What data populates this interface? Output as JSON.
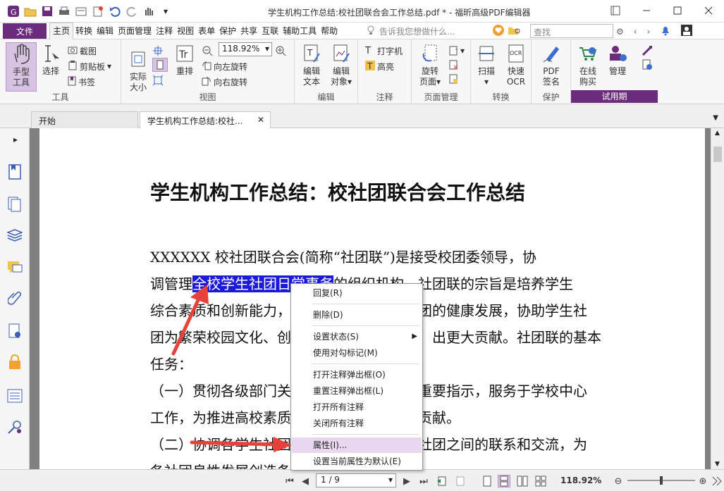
{
  "window": {
    "title": "学生机构工作总结:校社团联合会工作总结.pdf * - 福昕高级PDF编辑器"
  },
  "menu": {
    "file": "文件",
    "items": [
      "主页",
      "转换",
      "编辑",
      "页面管理",
      "注释",
      "视图",
      "表单",
      "保护",
      "共享",
      "互联",
      "辅助工具",
      "帮助"
    ],
    "active_index": 0,
    "tell_me": "告诉我您想做什么...",
    "search_placeholder": "查找"
  },
  "ribbon": {
    "tools": {
      "hand": "手型\n工具",
      "select": "选择",
      "snapshot": "截图",
      "clipboard": "剪贴板",
      "bookmark": "书签",
      "label": "工具"
    },
    "view": {
      "actual_size": "实际\n大小",
      "reflow": "重排",
      "zoom": "118.92%",
      "rotate_left": "向左旋转",
      "rotate_right": "向右旋转",
      "label": "视图"
    },
    "edit": {
      "edit_text": "编辑\n文本",
      "edit_object": "编辑\n对象",
      "label": "编辑"
    },
    "comment": {
      "typewriter": "打字机",
      "highlight": "高亮",
      "label": "注释"
    },
    "pages": {
      "rotate_page": "旋转\n页面",
      "label": "页面管理"
    },
    "convert": {
      "scan": "扫描",
      "ocr": "快速\nOCR",
      "label": "转换"
    },
    "protect": {
      "sign": "PDF\n签名",
      "label": "保护"
    },
    "trial": {
      "buy": "在线\n购买",
      "manage": "管理",
      "label": "试用期"
    }
  },
  "tabs": [
    {
      "label": "开始",
      "active": false
    },
    {
      "label": "学生机构工作总结:校社...",
      "active": true
    }
  ],
  "document": {
    "title": "学生机构工作总结：校社团联合会工作总结",
    "lines": [
      "XXXXXX 校社团联合会(简称“社团联”)是接受校团委领导，协",
      "调管理",
      "全校学生社团日常事务",
      "的组织机构。社团联的宗旨是培养学生",
      "综合素质和创新能力，",
      "团的健康发展，协助学生社",
      "团为繁荣校园文化、创",
      "出更大贡献。社团联的基本",
      "任务：",
      "（一）贯彻各级部门关",
      "重要指示，服务于学校中心",
      "工作，为推进高校素质",
      "贡献。",
      "（二）协调各学生社团",
      "社团之间的联系和交流，为",
      "各社团良性发展创造条"
    ]
  },
  "context_menu": {
    "items": [
      {
        "label": "回复(R)"
      },
      {
        "label": "删除(D)"
      },
      {
        "label": "设置状态(S)",
        "submenu": true
      },
      {
        "label": "使用对勾标记(M)"
      },
      {
        "label": "打开注释弹出框(O)"
      },
      {
        "label": "重置注释弹出框(L)"
      },
      {
        "label": "打开所有注释"
      },
      {
        "label": "关闭所有注释"
      },
      {
        "label": "属性(I)...",
        "highlighted": true
      },
      {
        "label": "设置当前属性为默认(E)"
      }
    ]
  },
  "status": {
    "page": "1 / 9",
    "zoom": "118.92%"
  },
  "colors": {
    "brand": "#6b2c7d",
    "selection": "#1a1ad8",
    "arrow": "#e8413a"
  }
}
